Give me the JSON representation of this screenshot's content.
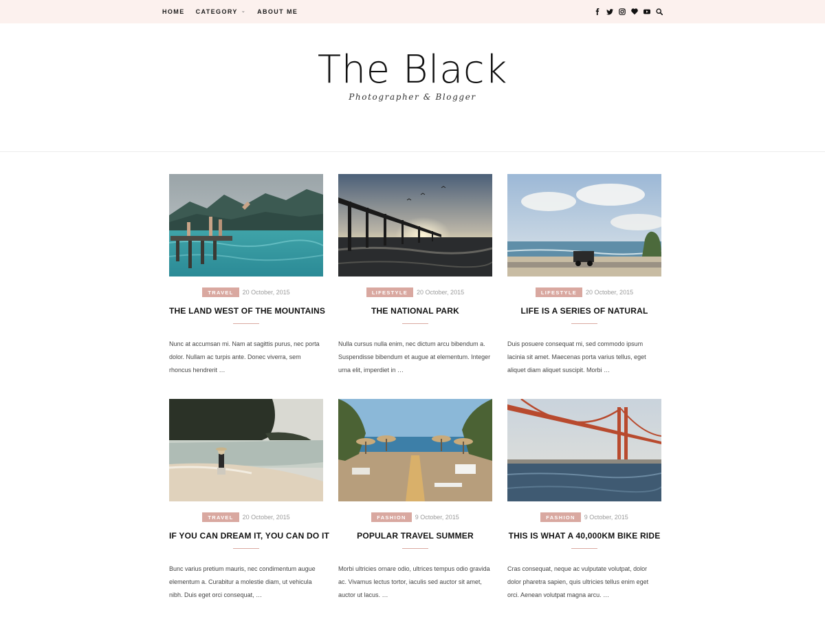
{
  "nav": {
    "items": [
      {
        "label": "HOME"
      },
      {
        "label": "CATEGORY"
      },
      {
        "label": "ABOUT ME"
      }
    ],
    "social_icons": [
      "facebook-icon",
      "twitter-icon",
      "instagram-icon",
      "heart-icon",
      "youtube-icon",
      "search-icon"
    ]
  },
  "header": {
    "title": "The Black",
    "subtitle": "Photographer & Blogger"
  },
  "colors": {
    "accent": "#d9a8a0",
    "topbar": "#fcf1ee"
  },
  "posts": [
    {
      "category": "TRAVEL",
      "date": "20 October, 2015",
      "title": "THE LAND WEST OF THE MOUNTAINS",
      "excerpt": "Nunc at accumsan mi. Nam at sagittis purus, nec porta dolor. Nullam ac turpis ante. Donec viverra, sem rhoncus hendrerit …"
    },
    {
      "category": "LIFESTYLE",
      "date": "20 October, 2015",
      "title": "THE NATIONAL PARK",
      "excerpt": "Nulla cursus nulla enim, nec dictum arcu bibendum a. Suspendisse bibendum et augue at elementum. Integer urna elit, imperdiet in …"
    },
    {
      "category": "LIFESTYLE",
      "date": "20 October, 2015",
      "title": "LIFE IS A SERIES OF NATURAL",
      "excerpt": "Duis posuere consequat mi, sed commodo ipsum lacinia sit amet. Maecenas porta varius tellus, eget aliquet diam aliquet suscipit. Morbi …"
    },
    {
      "category": "TRAVEL",
      "date": "20 October, 2015",
      "title": "IF YOU CAN DREAM IT, YOU CAN DO IT",
      "excerpt": "Bunc varius pretium mauris, nec condimentum augue elementum a. Curabitur a molestie diam, ut vehicula nibh. Duis eget orci consequat, …"
    },
    {
      "category": "FASHION",
      "date": "9 October, 2015",
      "title": "POPULAR TRAVEL SUMMER",
      "excerpt": "Morbi ultricies ornare odio, ultrices tempus odio gravida ac. Vivamus lectus tortor, iaculis sed auctor sit amet, auctor ut lacus. …"
    },
    {
      "category": "FASHION",
      "date": "9 October, 2015",
      "title": "THIS IS WHAT A 40,000KM BIKE RIDE",
      "excerpt": "Cras consequat, neque ac vulputate volutpat, dolor dolor pharetra sapien, quis ultricies tellus enim eget orci. Aenean volutpat magna arcu. …"
    }
  ]
}
